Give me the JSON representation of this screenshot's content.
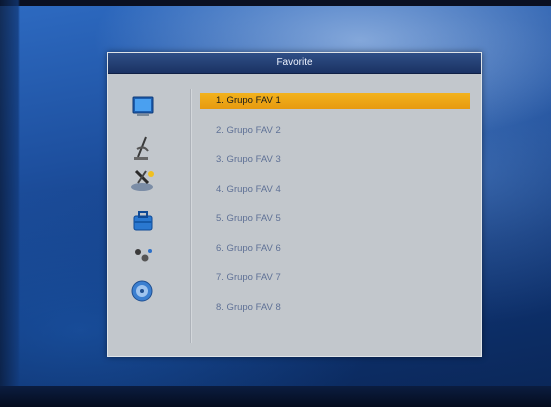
{
  "window": {
    "title": "Favorite"
  },
  "menu_icons": [
    {
      "name": "tv-screen-icon"
    },
    {
      "name": "satellite-dish-icon"
    },
    {
      "name": "configuration-tools-icon"
    },
    {
      "name": "toolbox-icon"
    },
    {
      "name": "games-icon"
    },
    {
      "name": "media-disc-icon"
    }
  ],
  "favorite_groups": [
    {
      "label": "1. Grupo FAV 1",
      "selected": true
    },
    {
      "label": "2. Grupo FAV 2",
      "selected": false
    },
    {
      "label": "3. Grupo FAV 3",
      "selected": false
    },
    {
      "label": "4. Grupo FAV 4",
      "selected": false
    },
    {
      "label": "5. Grupo FAV 5",
      "selected": false
    },
    {
      "label": "6. Grupo FAV 6",
      "selected": false
    },
    {
      "label": "7. Grupo FAV 7",
      "selected": false
    },
    {
      "label": "8. Grupo FAV 8",
      "selected": false
    }
  ],
  "colors": {
    "highlight": "#eea215",
    "title_bar": "#203a6f",
    "panel": "#c2c7cc",
    "item_text": "#5f7196"
  }
}
